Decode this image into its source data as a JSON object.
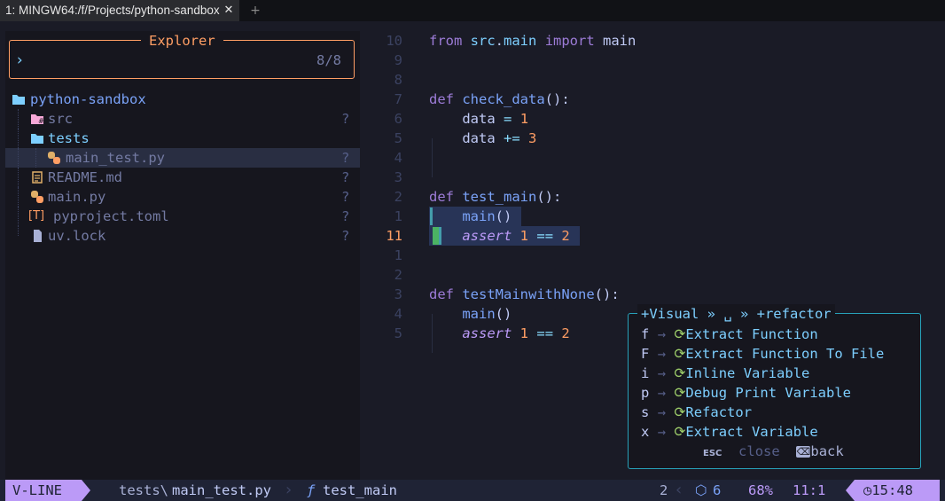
{
  "tabbar": {
    "tab_title": "1: MINGW64:/f/Projects/python-sandbox",
    "close_glyph": "✕",
    "add_glyph": "+"
  },
  "explorer": {
    "title": "Explorer",
    "prompt": "›",
    "counter": "8/8",
    "tree": [
      {
        "name": "python-sandbox",
        "icon": "folder-open-icon",
        "glyph": "▰",
        "git": ""
      },
      {
        "name": "src",
        "icon": "folder-src-icon",
        "glyph": "#",
        "git": "?"
      },
      {
        "name": "tests",
        "icon": "folder-open-icon",
        "glyph": "▰",
        "git": ""
      },
      {
        "name": "main_test.py",
        "icon": "python-icon",
        "glyph": "◆",
        "git": "?"
      },
      {
        "name": "README.md",
        "icon": "readme-icon",
        "glyph": "✎",
        "git": "?"
      },
      {
        "name": "main.py",
        "icon": "python-icon",
        "glyph": "◆",
        "git": "?"
      },
      {
        "name": "pyproject.toml",
        "icon": "toml-icon",
        "glyph": "[T]",
        "git": "?"
      },
      {
        "name": "uv.lock",
        "icon": "file-icon",
        "glyph": "▯",
        "git": "?"
      }
    ]
  },
  "editor": {
    "lines": [
      {
        "ln": "10",
        "tokens": [
          [
            "kw",
            "from"
          ],
          [
            "plain",
            " "
          ],
          [
            "mod",
            "src"
          ],
          [
            "plain",
            "."
          ],
          [
            "mod",
            "main"
          ],
          [
            "plain",
            " "
          ],
          [
            "kw",
            "import"
          ],
          [
            "plain",
            " main"
          ]
        ]
      },
      {
        "ln": "9",
        "tokens": []
      },
      {
        "ln": "8",
        "tokens": []
      },
      {
        "ln": "7",
        "tokens": [
          [
            "kw",
            "def"
          ],
          [
            "plain",
            " "
          ],
          [
            "fn",
            "check_data"
          ],
          [
            "plain",
            "():"
          ]
        ]
      },
      {
        "ln": "6",
        "tokens": [
          [
            "plain",
            "    data "
          ],
          [
            "op",
            "="
          ],
          [
            "plain",
            " "
          ],
          [
            "num",
            "1"
          ]
        ]
      },
      {
        "ln": "5",
        "tokens": [
          [
            "plain",
            "    data "
          ],
          [
            "op",
            "+="
          ],
          [
            "plain",
            " "
          ],
          [
            "num",
            "3"
          ]
        ]
      },
      {
        "ln": "4",
        "tokens": []
      },
      {
        "ln": "3",
        "tokens": []
      },
      {
        "ln": "2",
        "tokens": [
          [
            "kw",
            "def"
          ],
          [
            "plain",
            " "
          ],
          [
            "fn",
            "test_main"
          ],
          [
            "plain",
            "():"
          ]
        ]
      },
      {
        "ln": "1",
        "tokens": [
          [
            "plain",
            "    "
          ],
          [
            "fn",
            "main"
          ],
          [
            "plain",
            "()"
          ]
        ]
      },
      {
        "ln": "11",
        "tokens": [
          [
            "plain",
            "    "
          ],
          [
            "it",
            "assert"
          ],
          [
            "plain",
            " "
          ],
          [
            "num",
            "1"
          ],
          [
            "plain",
            " "
          ],
          [
            "op",
            "=="
          ],
          [
            "plain",
            " "
          ],
          [
            "num",
            "2"
          ]
        ]
      },
      {
        "ln": "1",
        "tokens": []
      },
      {
        "ln": "2",
        "tokens": []
      },
      {
        "ln": "3",
        "tokens": [
          [
            "kw",
            "def"
          ],
          [
            "plain",
            " "
          ],
          [
            "fn",
            "testMainwithNone"
          ],
          [
            "plain",
            "():"
          ]
        ]
      },
      {
        "ln": "4",
        "tokens": [
          [
            "plain",
            "    "
          ],
          [
            "fn",
            "main"
          ],
          [
            "plain",
            "()"
          ]
        ]
      },
      {
        "ln": "5",
        "tokens": [
          [
            "plain",
            "    "
          ],
          [
            "it",
            "assert"
          ],
          [
            "plain",
            " "
          ],
          [
            "num",
            "1"
          ],
          [
            "plain",
            " "
          ],
          [
            "op",
            "=="
          ],
          [
            "plain",
            " "
          ],
          [
            "num",
            "2"
          ]
        ]
      }
    ]
  },
  "whichkey": {
    "title": "+Visual » ␣ » +refactor",
    "items": [
      {
        "key": "f",
        "label": "Extract Function"
      },
      {
        "key": "F",
        "label": "Extract Function To File"
      },
      {
        "key": "i",
        "label": "Inline Variable"
      },
      {
        "key": "p",
        "label": "Debug Print Variable"
      },
      {
        "key": "s",
        "label": "Refactor"
      },
      {
        "key": "x",
        "label": "Extract Variable"
      }
    ],
    "arrow": "→",
    "item_glyph": "⟳",
    "esc_key": "ESC",
    "close_label": "close",
    "back_glyph": "⌫",
    "back_label": "back"
  },
  "statusline": {
    "mode": "V-LINE",
    "file_dir": "tests\\",
    "file_name": "main_test.py",
    "func_glyph": "ƒ",
    "func_name": "test_main",
    "sel_lines": "2",
    "lsp_glyph": "⬡",
    "lsp_count": "6",
    "progress": "68%",
    "position": "11:1",
    "clock_glyph": "◷",
    "clock": "15:48"
  },
  "colors": {
    "accent": "#bb9af7",
    "border_explorer": "#ff9e64",
    "border_whichkey": "#27a1b9",
    "background": "#1a1b26"
  }
}
